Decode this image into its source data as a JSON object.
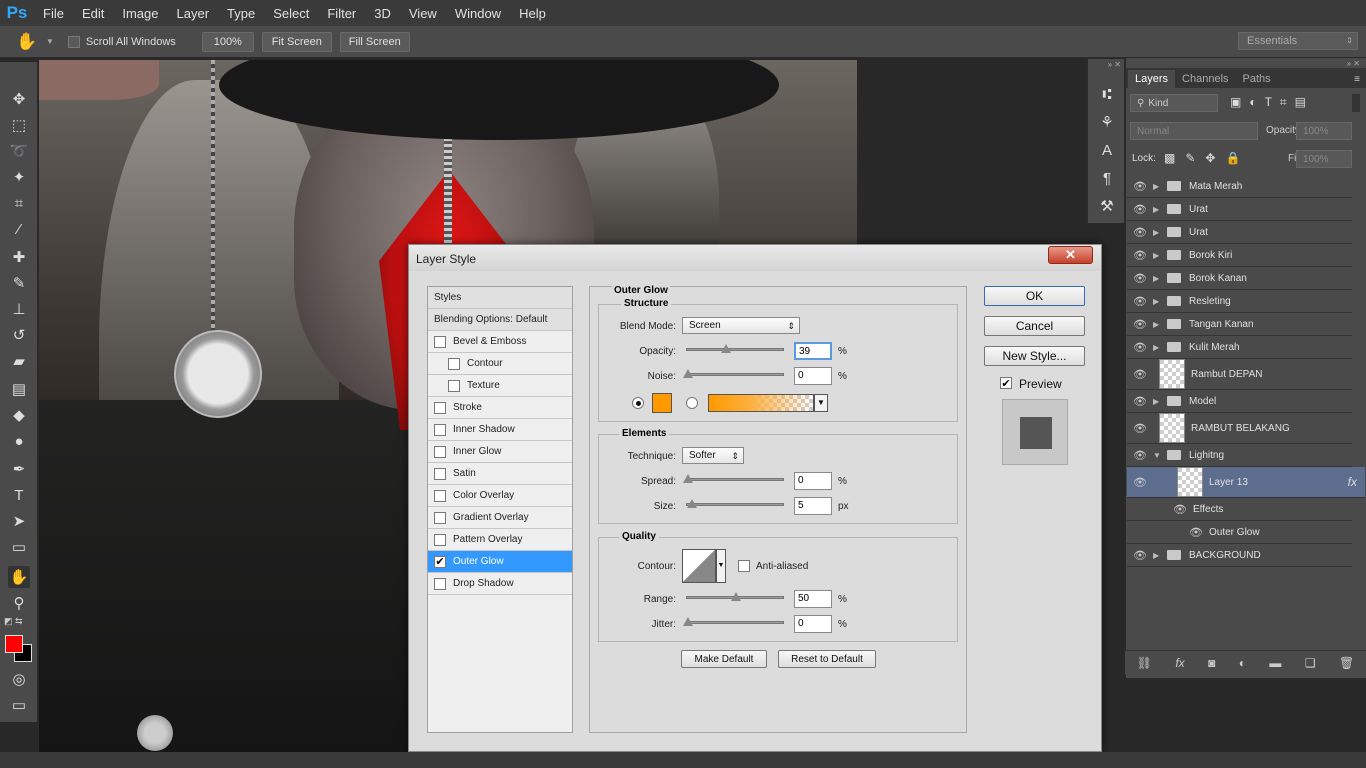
{
  "app": {
    "logo": "Ps",
    "menu": [
      "File",
      "Edit",
      "Image",
      "Layer",
      "Type",
      "Select",
      "Filter",
      "3D",
      "View",
      "Window",
      "Help"
    ]
  },
  "options": {
    "scroll_all": "Scroll All Windows",
    "zoom_100": "100%",
    "fit_screen": "Fit Screen",
    "fill_screen": "Fill Screen",
    "workspace": "Essentials"
  },
  "layers_panel": {
    "tabs": [
      "Layers",
      "Channels",
      "Paths"
    ],
    "kind": "Kind",
    "blend": "Normal",
    "opacity_label": "Opacity:",
    "opacity": "100%",
    "lock_label": "Lock:",
    "fill_label": "Fill:",
    "fill": "100%",
    "layers": [
      {
        "name": "Mata Merah",
        "type": "group"
      },
      {
        "name": "Urat",
        "type": "group"
      },
      {
        "name": "Urat",
        "type": "group"
      },
      {
        "name": "Borok Kiri",
        "type": "group"
      },
      {
        "name": "Borok Kanan",
        "type": "group"
      },
      {
        "name": "Resleting",
        "type": "group"
      },
      {
        "name": "Tangan Kanan",
        "type": "group"
      },
      {
        "name": "Kulit Merah",
        "type": "group"
      },
      {
        "name": "Rambut DEPAN",
        "type": "layer"
      },
      {
        "name": "Model",
        "type": "group"
      },
      {
        "name": "RAMBUT BELAKANG",
        "type": "layer"
      },
      {
        "name": "Lighitng",
        "type": "group-open"
      },
      {
        "name": "Layer 13",
        "type": "layer-selected",
        "fx": "fx"
      },
      {
        "name": "Effects",
        "type": "effects"
      },
      {
        "name": "Outer Glow",
        "type": "effect"
      },
      {
        "name": "BACKGROUND",
        "type": "group"
      }
    ]
  },
  "dialog": {
    "title": "Layer Style",
    "close": "✕",
    "styles_list": [
      {
        "label": "Styles",
        "kind": "head"
      },
      {
        "label": "Blending Options: Default",
        "kind": "head"
      },
      {
        "label": "Bevel & Emboss",
        "kind": "check",
        "checked": false
      },
      {
        "label": "Contour",
        "kind": "sub",
        "checked": false
      },
      {
        "label": "Texture",
        "kind": "sub",
        "checked": false
      },
      {
        "label": "Stroke",
        "kind": "check",
        "checked": false
      },
      {
        "label": "Inner Shadow",
        "kind": "check",
        "checked": false
      },
      {
        "label": "Inner Glow",
        "kind": "check",
        "checked": false
      },
      {
        "label": "Satin",
        "kind": "check",
        "checked": false
      },
      {
        "label": "Color Overlay",
        "kind": "check",
        "checked": false
      },
      {
        "label": "Gradient Overlay",
        "kind": "check",
        "checked": false
      },
      {
        "label": "Pattern Overlay",
        "kind": "check",
        "checked": false
      },
      {
        "label": "Outer Glow",
        "kind": "check",
        "checked": true,
        "selected": true
      },
      {
        "label": "Drop Shadow",
        "kind": "check",
        "checked": false
      }
    ],
    "section_title": "Outer Glow",
    "structure": {
      "title": "Structure",
      "blend_label": "Blend Mode:",
      "blend": "Screen",
      "opacity_label": "Opacity:",
      "opacity": "39",
      "noise_label": "Noise:",
      "noise": "0",
      "unit": "%",
      "glow_color": "#ff9900"
    },
    "elements": {
      "title": "Elements",
      "technique_label": "Technique:",
      "technique": "Softer",
      "spread_label": "Spread:",
      "spread": "0",
      "size_label": "Size:",
      "size": "5",
      "pct": "%",
      "px": "px"
    },
    "quality": {
      "title": "Quality",
      "contour_label": "Contour:",
      "anti_aliased": "Anti-aliased",
      "range_label": "Range:",
      "range": "50",
      "jitter_label": "Jitter:",
      "jitter": "0",
      "unit": "%"
    },
    "make_default": "Make Default",
    "reset_default": "Reset to Default",
    "ok": "OK",
    "cancel": "Cancel",
    "new_style": "New Style...",
    "preview": "Preview"
  },
  "colors": {
    "foreground": "#ff0000",
    "background": "#000000",
    "selection": "#3399ff",
    "layer_selected": "#5c6d8e"
  }
}
